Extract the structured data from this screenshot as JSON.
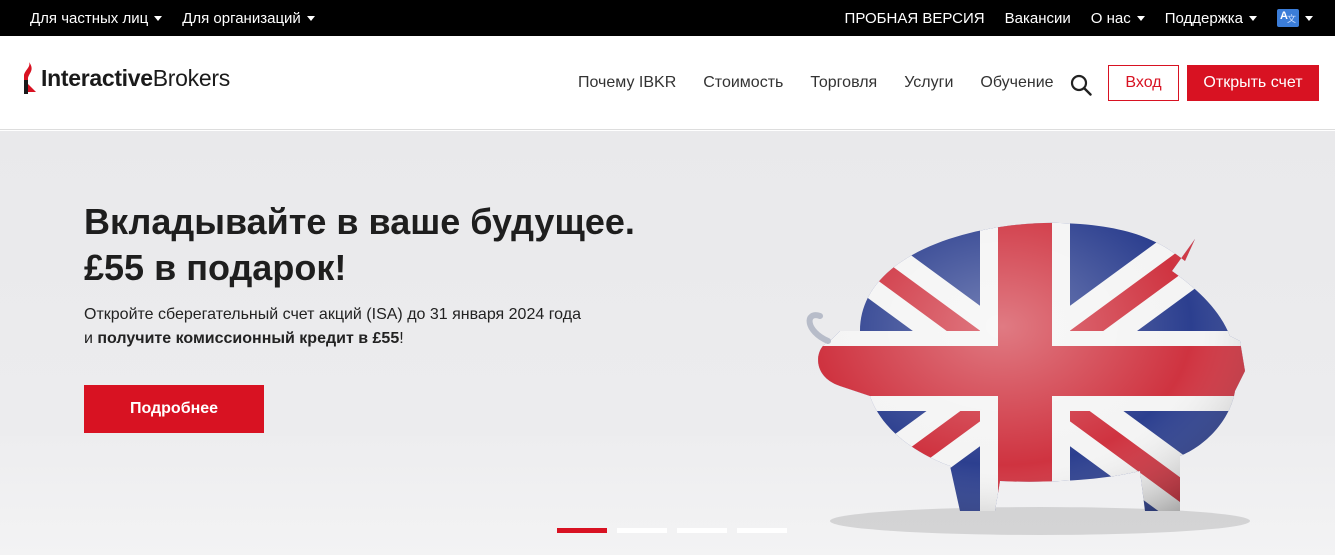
{
  "topbar": {
    "left_items": [
      "Для частных лиц",
      "Для организаций"
    ],
    "trial": "ПРОБНАЯ ВЕРСИЯ",
    "careers": "Вакансии",
    "about": "О нас",
    "support": "Поддержка",
    "lang_icon": "translate-icon"
  },
  "header": {
    "logo_bold": "Interactive",
    "logo_regular": "Brokers",
    "nav": [
      "Почему IBKR",
      "Стоимость",
      "Торговля",
      "Услуги",
      "Обучение"
    ],
    "search_icon": "search-icon",
    "login": "Вход",
    "open_account": "Открыть счет"
  },
  "hero": {
    "title_line1": "Вкладывайте в ваше будущее.",
    "title_line2": "£55 в подарок!",
    "sub_line1": "Откройте сберегательный счет акций (ISA) до 31 января 2024 года",
    "sub_line2_prefix": "и",
    "sub_line2_bold": "получите комиссионный кредит в £55",
    "sub_line2_suffix": "!",
    "cta": "Подробнее",
    "image": "union-jack-piggy-bank",
    "slides_total": 4,
    "active_slide": 1
  },
  "colors": {
    "accent": "#d81222",
    "topbar_bg": "#000000"
  }
}
